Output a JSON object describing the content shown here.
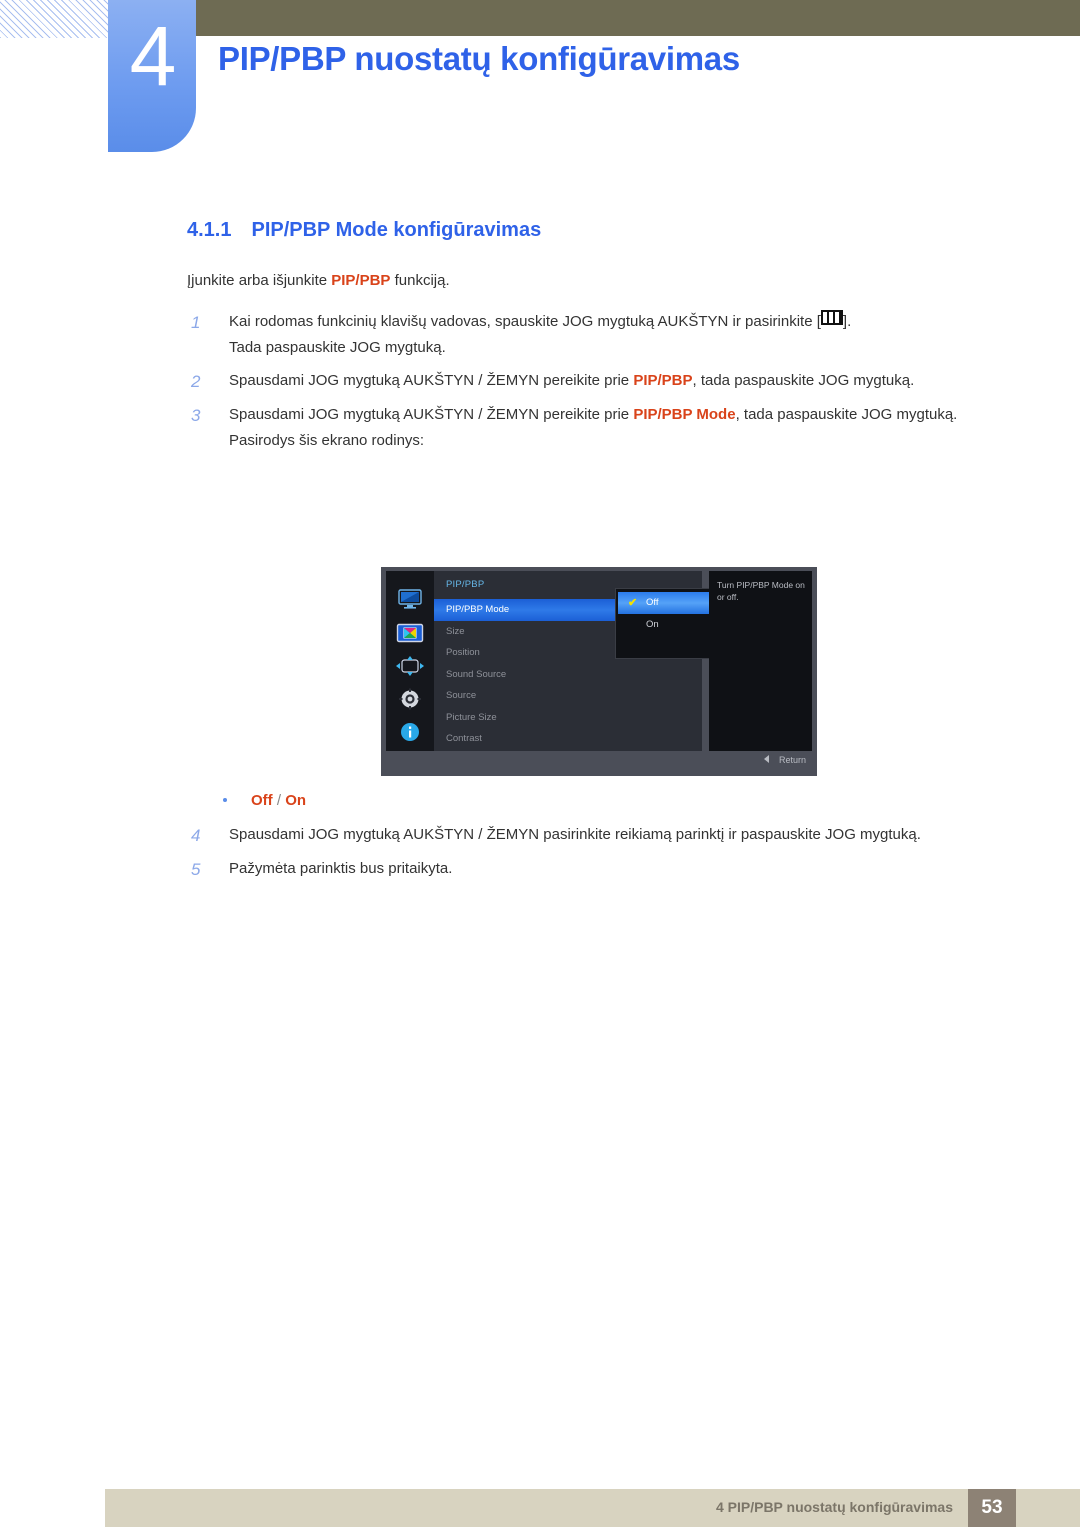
{
  "header": {
    "chapter_number": "4",
    "title": "PIP/PBP nuostatų konfigūravimas",
    "accent_color": "#2f62e8",
    "bar_color": "#6e6b53"
  },
  "section": {
    "number": "4.1.1",
    "title": "PIP/PBP Mode konfigūravimas"
  },
  "intro": {
    "before": "Įjunkite arba išjunkite ",
    "keyword": "PIP/PBP",
    "after": " funkciją."
  },
  "steps": [
    {
      "n": "1",
      "parts": [
        {
          "t": "Kai rodomas funkcinių klavišų vadovas, spauskite JOG mygtuką AUKŠTYN ir pasirinkite ["
        },
        {
          "icon": "pip-pbp-icon"
        },
        {
          "t": "]."
        }
      ],
      "line2": "Tada paspauskite JOG mygtuką."
    },
    {
      "n": "2",
      "parts": [
        {
          "t": "Spausdami JOG mygtuką AUKŠTYN / ŽEMYN pereikite prie "
        },
        {
          "kw": "PIP/PBP"
        },
        {
          "t": ", tada paspauskite JOG mygtuką."
        }
      ]
    },
    {
      "n": "3",
      "parts": [
        {
          "t": "Spausdami JOG mygtuką AUKŠTYN / ŽEMYN pereikite prie "
        },
        {
          "kw": "PIP/PBP Mode"
        },
        {
          "t": ", tada paspauskite JOG mygtuką."
        }
      ],
      "line2": "Pasirodys šis ekrano rodinys:"
    }
  ],
  "step1_text": "Kai rodomas funkcinių klavišų vadovas, spauskite JOG mygtuką AUKŠTYN ir pasirinkite [",
  "step1_tail": "].",
  "step1_line2": "Tada paspauskite JOG mygtuką.",
  "step2_pre": "Spausdami JOG mygtuką AUKŠTYN / ŽEMYN pereikite prie ",
  "step2_kw": "PIP/PBP",
  "step2_post": ", tada paspauskite JOG mygtuką.",
  "step3_pre": "Spausdami JOG mygtuką AUKŠTYN / ŽEMYN pereikite prie ",
  "step3_kw": "PIP/PBP Mode",
  "step3_post": ", tada paspauskite JOG mygtuką.",
  "step3_line2": "Pasirodys šis ekrano rodinys:",
  "step_numbers": {
    "one": "1",
    "two": "2",
    "three": "3",
    "four": "4",
    "five": "5"
  },
  "bullet": {
    "option_off": "Off",
    "separator": "/",
    "option_on": "On"
  },
  "step4_text": "Spausdami JOG mygtuką AUKŠTYN / ŽEMYN pasirinkite reikiamą parinktį ir paspauskite JOG mygtuką.",
  "step5_text": "Pažymėta parinktis bus pritaikyta.",
  "osd": {
    "menu_title": "PIP/PBP",
    "items": [
      "PIP/PBP Mode",
      "Size",
      "Position",
      "Sound Source",
      "Source",
      "Picture Size",
      "Contrast"
    ],
    "selected_item": "PIP/PBP Mode",
    "submenu": {
      "options": [
        "Off",
        "On"
      ],
      "checked": "Off",
      "check_glyph": "✔"
    },
    "help_text": "Turn PIP/PBP Mode on or off.",
    "return_label": "Return",
    "icons": [
      "display-icon",
      "picture-icon",
      "pip-position-icon",
      "system-gear-icon",
      "information-icon"
    ],
    "highlight_color": "#2f7ae8",
    "title_color": "#66b7e8"
  },
  "footer": {
    "text": "4 PIP/PBP nuostatų konfigūravimas",
    "page": "53",
    "band_color": "#d8d3c0",
    "page_box_color": "#8d8275"
  }
}
